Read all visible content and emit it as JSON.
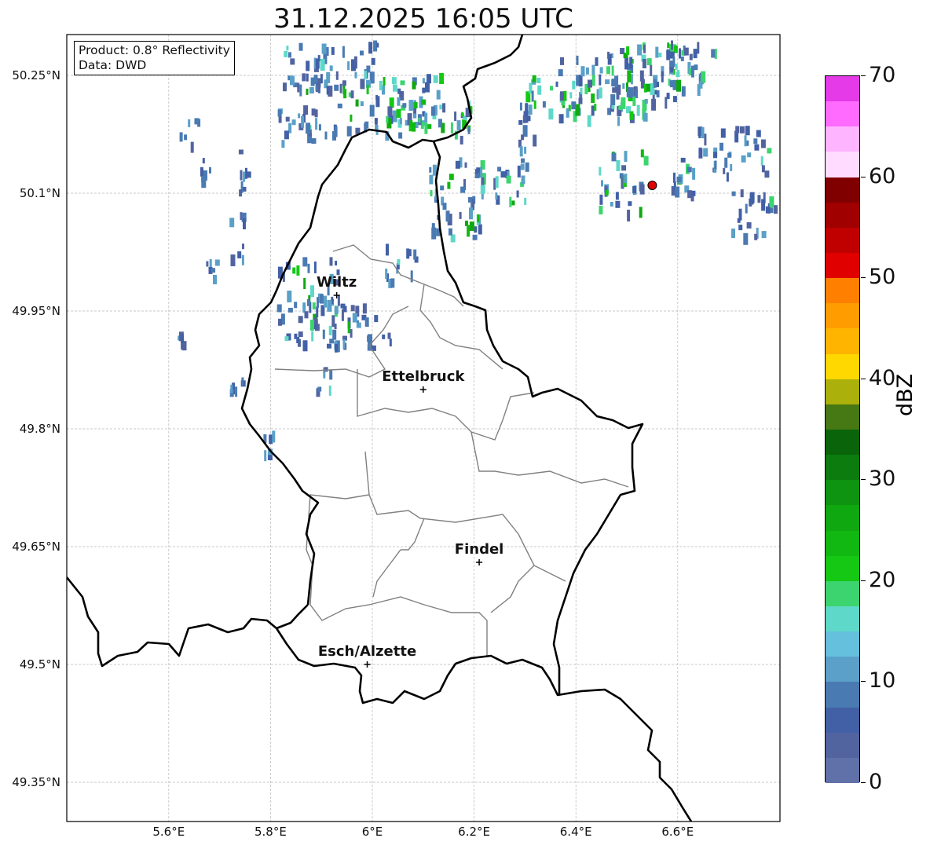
{
  "title": "31.12.2025 16:05 UTC",
  "info": {
    "product": "Product: 0.8° Reflectivity",
    "data": "Data: DWD"
  },
  "axes": {
    "x_ticks": [
      "5.6°E",
      "5.8°E",
      "6°E",
      "6.2°E",
      "6.4°E",
      "6.6°E"
    ],
    "y_ticks": [
      "50.25°N",
      "50.1°N",
      "49.95°N",
      "49.8°N",
      "49.65°N",
      "49.5°N",
      "49.35°N"
    ]
  },
  "cities": [
    {
      "name": "Wiltz",
      "lon": 5.93,
      "lat": 49.97
    },
    {
      "name": "Ettelbruck",
      "lon": 6.1,
      "lat": 49.85
    },
    {
      "name": "Findel",
      "lon": 6.21,
      "lat": 49.63
    },
    {
      "name": "Esch/Alzette",
      "lon": 5.99,
      "lat": 49.5
    }
  ],
  "marker": {
    "lon": 6.55,
    "lat": 50.11,
    "color": "#e00000"
  },
  "colorbar": {
    "label": "dBZ",
    "ticks": [
      "0",
      "10",
      "20",
      "30",
      "40",
      "50",
      "60",
      "70"
    ],
    "colors": [
      "#6070a8",
      "#5264a0",
      "#4260a6",
      "#4a7ab2",
      "#5aa0c8",
      "#64c0dc",
      "#5ed8c8",
      "#3cd46e",
      "#14c814",
      "#12b812",
      "#10a810",
      "#0e9410",
      "#0c7c0e",
      "#0a640a",
      "#467814",
      "#acb00a",
      "#ffd800",
      "#ffb400",
      "#ff9c00",
      "#ff8000",
      "#e00000",
      "#c00000",
      "#a00000",
      "#800000",
      "#ffdcff",
      "#ffb4ff",
      "#ff6aff",
      "#e43ae8"
    ]
  }
}
